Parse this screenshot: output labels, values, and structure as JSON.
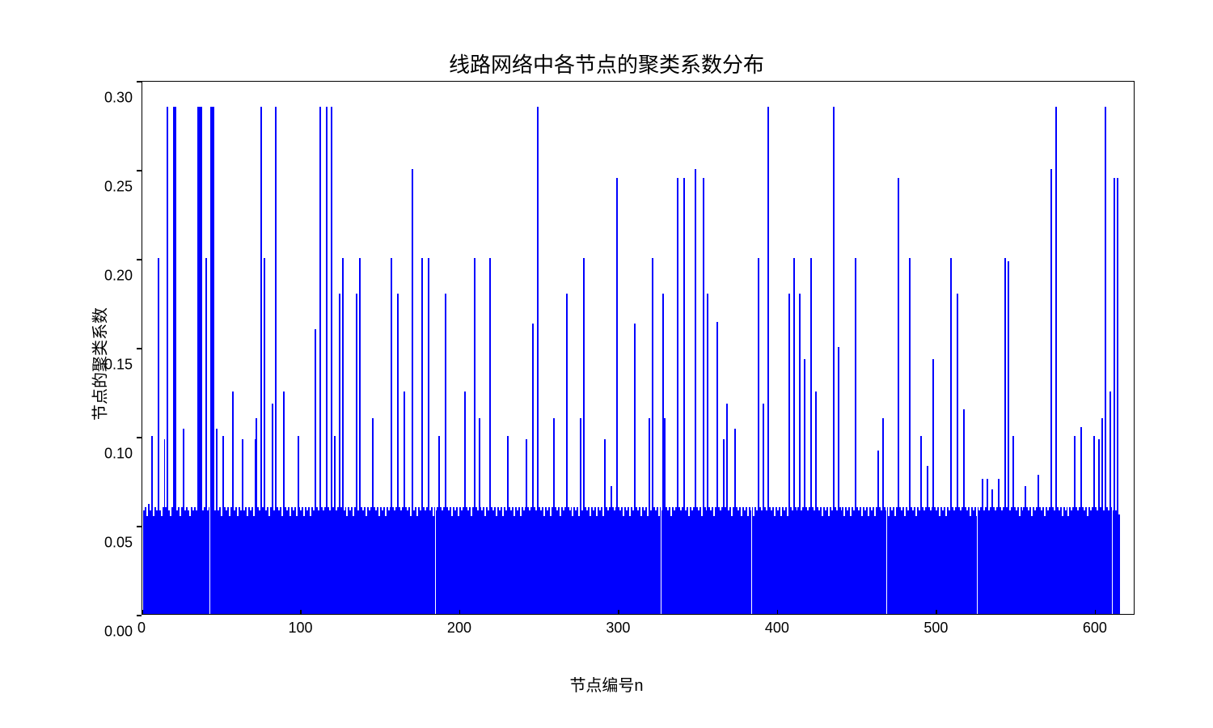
{
  "chart_data": {
    "type": "bar",
    "title": "线路网络中各节点的聚类系数分布",
    "xlabel": "节点编号n",
    "ylabel": "节点的聚类系数",
    "xlim": [
      0,
      625
    ],
    "ylim": [
      0.0,
      0.3
    ],
    "x_start": 1,
    "x_count": 615,
    "y_ticks": [
      0.0,
      0.05,
      0.1,
      0.15,
      0.2,
      0.25,
      0.3
    ],
    "y_tick_labels": [
      "0.00",
      "0.05",
      "0.10",
      "0.15",
      "0.20",
      "0.25",
      "0.30"
    ],
    "x_ticks": [
      0,
      100,
      200,
      300,
      400,
      500,
      600
    ],
    "bar_color": "#0000ff",
    "note": "Values are read-off estimates from pixel heights; clustering coefficient per node (n=1..615).",
    "values": [
      0.058,
      0.06,
      0.055,
      0.062,
      0.058,
      0.1,
      0.055,
      0.06,
      0.058,
      0.2,
      0.058,
      0.055,
      0.06,
      0.098,
      0.06,
      0.285,
      0.058,
      0.055,
      0.06,
      0.285,
      0.285,
      0.058,
      0.06,
      0.055,
      0.06,
      0.104,
      0.058,
      0.06,
      0.058,
      0.055,
      0.06,
      0.058,
      0.06,
      0.058,
      0.285,
      0.285,
      0.285,
      0.058,
      0.06,
      0.2,
      0.058,
      0.06,
      0.285,
      0.285,
      0.285,
      0.058,
      0.104,
      0.058,
      0.06,
      0.055,
      0.1,
      0.06,
      0.058,
      0.06,
      0.055,
      0.06,
      0.125,
      0.058,
      0.06,
      0.055,
      0.06,
      0.058,
      0.098,
      0.058,
      0.06,
      0.055,
      0.06,
      0.058,
      0.06,
      0.055,
      0.098,
      0.11,
      0.06,
      0.058,
      0.285,
      0.06,
      0.2,
      0.058,
      0.06,
      0.055,
      0.06,
      0.118,
      0.058,
      0.285,
      0.06,
      0.058,
      0.06,
      0.055,
      0.125,
      0.06,
      0.058,
      0.06,
      0.055,
      0.06,
      0.058,
      0.06,
      0.055,
      0.1,
      0.06,
      0.058,
      0.06,
      0.055,
      0.06,
      0.058,
      0.06,
      0.055,
      0.06,
      0.058,
      0.16,
      0.06,
      0.058,
      0.285,
      0.06,
      0.058,
      0.06,
      0.285,
      0.06,
      0.058,
      0.285,
      0.06,
      0.1,
      0.058,
      0.06,
      0.18,
      0.06,
      0.2,
      0.058,
      0.06,
      0.055,
      0.06,
      0.058,
      0.06,
      0.055,
      0.06,
      0.18,
      0.058,
      0.2,
      0.06,
      0.058,
      0.06,
      0.055,
      0.06,
      0.058,
      0.06,
      0.11,
      0.06,
      0.058,
      0.06,
      0.055,
      0.06,
      0.058,
      0.06,
      0.055,
      0.06,
      0.058,
      0.06,
      0.2,
      0.06,
      0.058,
      0.06,
      0.18,
      0.06,
      0.058,
      0.06,
      0.125,
      0.06,
      0.058,
      0.06,
      0.055,
      0.25,
      0.058,
      0.06,
      0.055,
      0.06,
      0.058,
      0.2,
      0.06,
      0.058,
      0.06,
      0.2,
      0.058,
      0.06,
      0.055,
      0.06,
      0.058,
      0.06,
      0.1,
      0.06,
      0.058,
      0.06,
      0.18,
      0.06,
      0.058,
      0.06,
      0.055,
      0.06,
      0.058,
      0.06,
      0.055,
      0.06,
      0.058,
      0.06,
      0.125,
      0.06,
      0.058,
      0.06,
      0.055,
      0.06,
      0.2,
      0.06,
      0.058,
      0.11,
      0.06,
      0.058,
      0.06,
      0.055,
      0.06,
      0.058,
      0.2,
      0.06,
      0.058,
      0.06,
      0.055,
      0.06,
      0.058,
      0.06,
      0.055,
      0.06,
      0.058,
      0.1,
      0.06,
      0.058,
      0.06,
      0.055,
      0.06,
      0.058,
      0.06,
      0.055,
      0.06,
      0.058,
      0.06,
      0.098,
      0.06,
      0.058,
      0.06,
      0.163,
      0.06,
      0.058,
      0.285,
      0.06,
      0.058,
      0.06,
      0.055,
      0.06,
      0.058,
      0.06,
      0.055,
      0.06,
      0.11,
      0.06,
      0.058,
      0.06,
      0.055,
      0.06,
      0.058,
      0.06,
      0.18,
      0.06,
      0.058,
      0.06,
      0.055,
      0.06,
      0.058,
      0.06,
      0.055,
      0.11,
      0.058,
      0.2,
      0.06,
      0.058,
      0.06,
      0.055,
      0.06,
      0.058,
      0.06,
      0.055,
      0.06,
      0.058,
      0.06,
      0.055,
      0.098,
      0.06,
      0.058,
      0.06,
      0.072,
      0.06,
      0.058,
      0.06,
      0.245,
      0.06,
      0.058,
      0.06,
      0.055,
      0.06,
      0.058,
      0.06,
      0.055,
      0.06,
      0.058,
      0.163,
      0.06,
      0.058,
      0.06,
      0.055,
      0.06,
      0.058,
      0.06,
      0.055,
      0.11,
      0.058,
      0.2,
      0.06,
      0.058,
      0.06,
      0.055,
      0.06,
      0.058,
      0.18,
      0.11,
      0.06,
      0.058,
      0.06,
      0.055,
      0.06,
      0.058,
      0.06,
      0.245,
      0.06,
      0.058,
      0.06,
      0.245,
      0.058,
      0.06,
      0.055,
      0.06,
      0.058,
      0.06,
      0.25,
      0.06,
      0.058,
      0.06,
      0.055,
      0.245,
      0.06,
      0.058,
      0.18,
      0.06,
      0.058,
      0.06,
      0.055,
      0.06,
      0.164,
      0.06,
      0.058,
      0.06,
      0.098,
      0.06,
      0.118,
      0.058,
      0.06,
      0.055,
      0.06,
      0.104,
      0.06,
      0.058,
      0.06,
      0.055,
      0.06,
      0.058,
      0.06,
      0.055,
      0.06,
      0.058,
      0.06,
      0.055,
      0.06,
      0.058,
      0.2,
      0.06,
      0.058,
      0.118,
      0.06,
      0.058,
      0.285,
      0.06,
      0.058,
      0.06,
      0.055,
      0.06,
      0.058,
      0.06,
      0.055,
      0.06,
      0.058,
      0.06,
      0.055,
      0.18,
      0.06,
      0.058,
      0.2,
      0.06,
      0.058,
      0.06,
      0.18,
      0.058,
      0.06,
      0.143,
      0.06,
      0.058,
      0.06,
      0.2,
      0.06,
      0.058,
      0.125,
      0.06,
      0.058,
      0.06,
      0.055,
      0.06,
      0.058,
      0.06,
      0.055,
      0.06,
      0.058,
      0.285,
      0.06,
      0.058,
      0.15,
      0.06,
      0.058,
      0.06,
      0.055,
      0.06,
      0.058,
      0.06,
      0.055,
      0.06,
      0.058,
      0.2,
      0.06,
      0.058,
      0.06,
      0.055,
      0.06,
      0.058,
      0.06,
      0.055,
      0.06,
      0.058,
      0.06,
      0.055,
      0.06,
      0.092,
      0.06,
      0.058,
      0.11,
      0.06,
      0.058,
      0.06,
      0.055,
      0.06,
      0.058,
      0.06,
      0.055,
      0.06,
      0.245,
      0.06,
      0.058,
      0.06,
      0.055,
      0.06,
      0.058,
      0.2,
      0.06,
      0.058,
      0.06,
      0.055,
      0.06,
      0.058,
      0.1,
      0.06,
      0.058,
      0.06,
      0.083,
      0.06,
      0.058,
      0.06,
      0.143,
      0.06,
      0.058,
      0.06,
      0.055,
      0.06,
      0.058,
      0.06,
      0.055,
      0.06,
      0.058,
      0.2,
      0.06,
      0.058,
      0.06,
      0.18,
      0.06,
      0.058,
      0.06,
      0.115,
      0.06,
      0.058,
      0.06,
      0.055,
      0.06,
      0.058,
      0.06,
      0.055,
      0.06,
      0.058,
      0.06,
      0.076,
      0.058,
      0.06,
      0.076,
      0.058,
      0.06,
      0.07,
      0.06,
      0.058,
      0.06,
      0.076,
      0.06,
      0.058,
      0.06,
      0.2,
      0.06,
      0.198,
      0.058,
      0.06,
      0.1,
      0.06,
      0.058,
      0.06,
      0.055,
      0.06,
      0.058,
      0.06,
      0.072,
      0.06,
      0.058,
      0.06,
      0.055,
      0.06,
      0.058,
      0.06,
      0.078,
      0.06,
      0.058,
      0.06,
      0.055,
      0.06,
      0.058,
      0.06,
      0.25,
      0.06,
      0.058,
      0.285,
      0.06,
      0.058,
      0.06,
      0.055,
      0.06,
      0.058,
      0.06,
      0.055,
      0.06,
      0.058,
      0.06,
      0.1,
      0.06,
      0.058,
      0.06,
      0.105,
      0.06,
      0.058,
      0.06,
      0.055,
      0.06,
      0.058,
      0.06,
      0.1,
      0.06,
      0.058,
      0.098,
      0.06,
      0.11,
      0.058,
      0.285,
      0.06,
      0.058,
      0.125,
      0.06,
      0.058,
      0.245,
      0.058,
      0.245,
      0.056
    ]
  }
}
